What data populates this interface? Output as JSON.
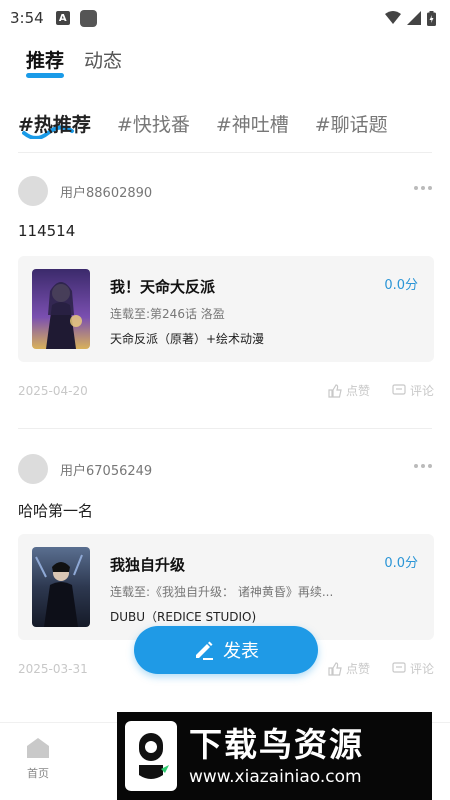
{
  "status_bar": {
    "time": "3:54",
    "a_icon": "A"
  },
  "top_tabs": [
    {
      "label": "推荐",
      "active": true
    },
    {
      "label": "动态",
      "active": false
    }
  ],
  "topic_tabs": [
    {
      "label": "#热推荐",
      "active": true
    },
    {
      "label": "#快找番",
      "active": false
    },
    {
      "label": "#神吐槽",
      "active": false
    },
    {
      "label": "#聊话题",
      "active": false
    }
  ],
  "posts": [
    {
      "username": "用户88602890",
      "text": "114514",
      "card": {
        "title": "我！天命大反派",
        "score": "0.0分",
        "sub": "连载至:第246话 洛盈",
        "author": "天命反派（原著）+绘术动漫"
      },
      "date": "2025-04-20",
      "like_label": "点赞",
      "comment_label": "评论"
    },
    {
      "username": "用户67056249",
      "text": "哈哈第一名",
      "card": {
        "title": "我独自升级",
        "score": "0.0分",
        "sub": "连载至:《我独自升级： 诸神黄昏》再续...",
        "author": "DUBU（REDICE STUDIO)"
      },
      "date": "2025-03-31",
      "like_label": "点赞",
      "comment_label": "评论"
    }
  ],
  "publish_button": {
    "label": "发表"
  },
  "bottom_nav": {
    "home_label": "首页"
  },
  "watermark": {
    "title": "下载鸟资源",
    "url": "www.xiazainiao.com"
  },
  "colors": {
    "accent": "#1f9ae6",
    "score": "#2b95d6",
    "muted": "#c8c8c8"
  }
}
